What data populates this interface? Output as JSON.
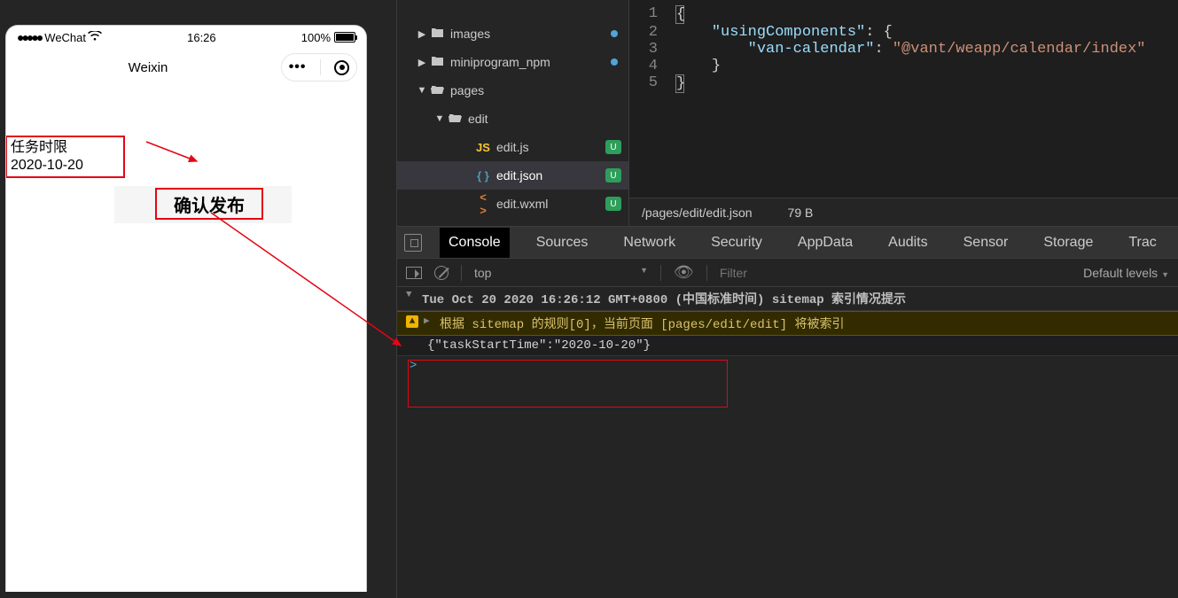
{
  "simulator": {
    "status": {
      "carrier": "WeChat",
      "time": "16:26",
      "battery_pct": "100%"
    },
    "nav": {
      "title": "Weixin"
    },
    "task_label": "任务时限",
    "task_date": "2020-10-20",
    "confirm_label": "确认发布"
  },
  "file_tree": {
    "items": [
      {
        "name": "images",
        "type": "folder",
        "indent": 22,
        "expanded": false,
        "modified": true
      },
      {
        "name": "miniprogram_npm",
        "type": "folder",
        "indent": 22,
        "expanded": false,
        "modified": true
      },
      {
        "name": "pages",
        "type": "folder",
        "indent": 22,
        "expanded": true
      },
      {
        "name": "edit",
        "type": "folder",
        "indent": 42,
        "expanded": true
      },
      {
        "name": "edit.js",
        "type": "js",
        "indent": 74,
        "badge": "U"
      },
      {
        "name": "edit.json",
        "type": "json",
        "indent": 74,
        "badge": "U",
        "selected": true
      },
      {
        "name": "edit.wxml",
        "type": "wxml",
        "indent": 74,
        "badge": "U"
      }
    ]
  },
  "editor": {
    "lines": [
      {
        "n": "1",
        "pre": "",
        "tokens": [
          {
            "t": "{",
            "c": ""
          }
        ],
        "box": true
      },
      {
        "n": "2",
        "pre": "    ",
        "tokens": [
          {
            "t": "\"usingComponents\"",
            "c": "key"
          },
          {
            "t": ": {",
            "c": ""
          }
        ]
      },
      {
        "n": "3",
        "pre": "        ",
        "tokens": [
          {
            "t": "\"van-calendar\"",
            "c": "key"
          },
          {
            "t": ": ",
            "c": ""
          },
          {
            "t": "\"@vant/weapp/calendar/index\"",
            "c": "str"
          }
        ]
      },
      {
        "n": "4",
        "pre": "    ",
        "tokens": [
          {
            "t": "}",
            "c": ""
          }
        ]
      },
      {
        "n": "5",
        "pre": "",
        "tokens": [
          {
            "t": "}",
            "c": ""
          }
        ],
        "box": true
      }
    ],
    "status_path": "/pages/edit/edit.json",
    "status_size": "79 B"
  },
  "devtools": {
    "tabs": [
      "Console",
      "Sources",
      "Network",
      "Security",
      "AppData",
      "Audits",
      "Sensor",
      "Storage",
      "Trac"
    ],
    "active_tab": 0,
    "toolbar": {
      "context": "top",
      "filter_placeholder": "Filter",
      "levels": "Default levels"
    },
    "console": {
      "header": "Tue Oct 20 2020 16:26:12 GMT+0800 (中国标准时间) sitemap 索引情况提示",
      "warning": "根据 sitemap 的规则[0]，当前页面 [pages/edit/edit] 将被索引",
      "log": "{\"taskStartTime\":\"2020-10-20\"}",
      "prompt": ">"
    }
  }
}
